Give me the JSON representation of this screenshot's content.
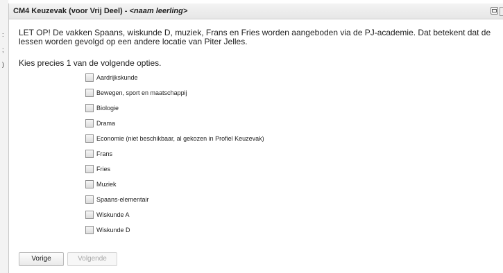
{
  "background": {
    "fragments": [
      ":",
      ";",
      ")"
    ]
  },
  "dialog": {
    "title_prefix": "CM4 Keuzevak (voor Vrij Deel) - ",
    "title_placeholder": "<naam leerling>",
    "notice": "LET OP! De vakken Spaans, wiskunde D, muziek, Frans en Fries worden aangeboden via de PJ-academie. Dat betekent dat de lessen worden gevolgd op een andere locatie van Piter Jelles.",
    "instruction": "Kies precies 1 van de volgende opties.",
    "options": [
      {
        "label": "Aardrijkskunde",
        "checked": false
      },
      {
        "label": "Bewegen, sport en maatschappij",
        "checked": false
      },
      {
        "label": "Biologie",
        "checked": false
      },
      {
        "label": "Drama",
        "checked": false
      },
      {
        "label": "Economie (niet beschikbaar, al gekozen in Profiel Keuzevak)",
        "checked": false
      },
      {
        "label": "Frans",
        "checked": false
      },
      {
        "label": "Fries",
        "checked": false
      },
      {
        "label": "Muziek",
        "checked": false
      },
      {
        "label": "Spaans-elementair",
        "checked": false
      },
      {
        "label": "Wiskunde A",
        "checked": false
      },
      {
        "label": "Wiskunde D",
        "checked": false
      }
    ],
    "buttons": {
      "previous": "Vorige",
      "next": "Volgende"
    }
  }
}
